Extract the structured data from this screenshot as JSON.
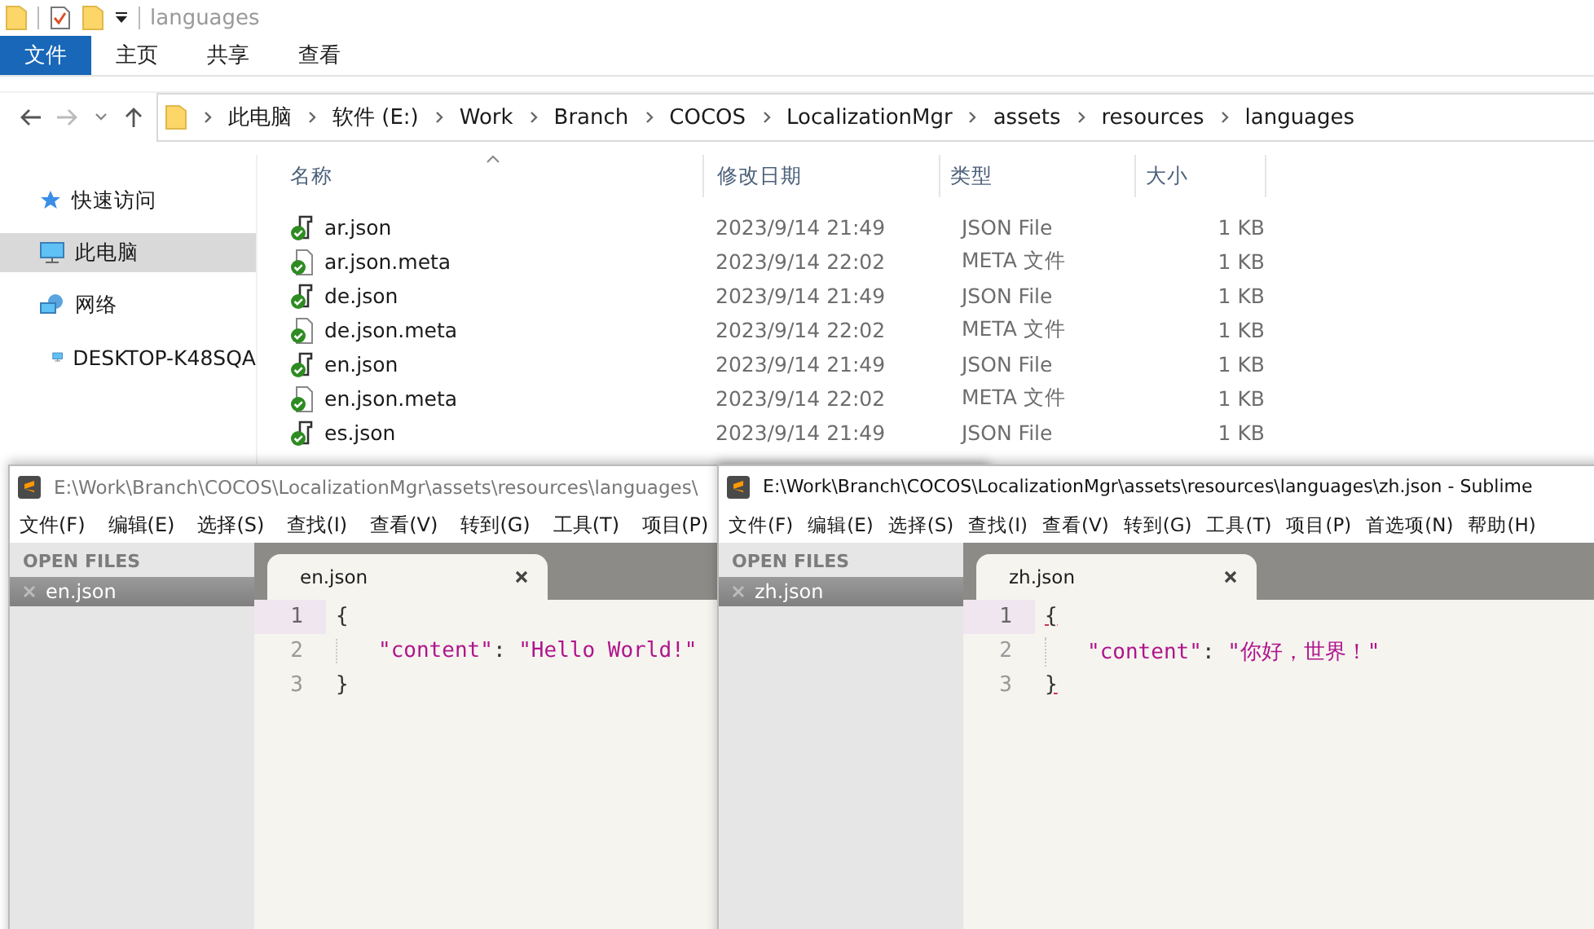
{
  "explorer": {
    "title": "languages",
    "ribbon_tabs": [
      {
        "label": "文件",
        "selected": true
      },
      {
        "label": "主页",
        "selected": false
      },
      {
        "label": "共享",
        "selected": false
      },
      {
        "label": "查看",
        "selected": false
      }
    ],
    "breadcrumb": [
      "此电脑",
      "软件 (E:)",
      "Work",
      "Branch",
      "COCOS",
      "LocalizationMgr",
      "assets",
      "resources",
      "languages"
    ],
    "nav_items": [
      {
        "label": "快速访问",
        "kind": "quick",
        "selected": false
      },
      {
        "label": "此电脑",
        "kind": "pc",
        "selected": true
      },
      {
        "label": "网络",
        "kind": "network",
        "selected": false,
        "children": [
          {
            "label": "DESKTOP-K48SQA",
            "kind": "pc",
            "selected": false
          }
        ]
      }
    ],
    "columns": [
      "名称",
      "修改日期",
      "类型",
      "大小"
    ],
    "files": [
      {
        "name": "ar.json",
        "modified": "2023/9/14 21:49",
        "type": "JSON File",
        "size": "1 KB",
        "kind": "json"
      },
      {
        "name": "ar.json.meta",
        "modified": "2023/9/14 22:02",
        "type": "META 文件",
        "size": "1 KB",
        "kind": "meta"
      },
      {
        "name": "de.json",
        "modified": "2023/9/14 21:49",
        "type": "JSON File",
        "size": "1 KB",
        "kind": "json"
      },
      {
        "name": "de.json.meta",
        "modified": "2023/9/14 22:02",
        "type": "META 文件",
        "size": "1 KB",
        "kind": "meta"
      },
      {
        "name": "en.json",
        "modified": "2023/9/14 21:49",
        "type": "JSON File",
        "size": "1 KB",
        "kind": "json"
      },
      {
        "name": "en.json.meta",
        "modified": "2023/9/14 22:02",
        "type": "META 文件",
        "size": "1 KB",
        "kind": "meta"
      },
      {
        "name": "es.json",
        "modified": "2023/9/14 21:49",
        "type": "JSON File",
        "size": "1 KB",
        "kind": "json"
      }
    ]
  },
  "editors": [
    {
      "title": "E:\\Work\\Branch\\COCOS\\LocalizationMgr\\assets\\resources\\languages\\",
      "menu": [
        "文件(F)",
        "编辑(E)",
        "选择(S)",
        "查找(I)",
        "查看(V)",
        "转到(G)",
        "工具(T)",
        "项目(P)"
      ],
      "sidebar_heading": "OPEN FILES",
      "open_files": [
        {
          "name": "en.json",
          "selected": true
        }
      ],
      "tab": "en.json",
      "lines": [
        {
          "number": "1",
          "current": true,
          "indented": false,
          "tokens": [
            {
              "kind": "punct",
              "text": "{"
            }
          ]
        },
        {
          "number": "2",
          "current": false,
          "indented": true,
          "tokens": [
            {
              "kind": "string",
              "text": "\"content\""
            },
            {
              "kind": "punct",
              "text": ": "
            },
            {
              "kind": "string",
              "text": "\"Hello World!\""
            }
          ]
        },
        {
          "number": "3",
          "current": false,
          "indented": false,
          "tokens": [
            {
              "kind": "punct",
              "text": "}"
            }
          ]
        }
      ]
    },
    {
      "title": "E:\\Work\\Branch\\COCOS\\LocalizationMgr\\assets\\resources\\languages\\zh.json - Sublime",
      "menu": [
        "文件(F)",
        "编辑(E)",
        "选择(S)",
        "查找(I)",
        "查看(V)",
        "转到(G)",
        "工具(T)",
        "项目(P)",
        "首选项(N)",
        "帮助(H)"
      ],
      "sidebar_heading": "OPEN FILES",
      "open_files": [
        {
          "name": "zh.json",
          "selected": true
        }
      ],
      "tab": "zh.json",
      "lines": [
        {
          "number": "1",
          "current": true,
          "indented": false,
          "tokens": [
            {
              "kind": "brace_match",
              "text": "{"
            }
          ]
        },
        {
          "number": "2",
          "current": false,
          "indented": true,
          "tokens": [
            {
              "kind": "string",
              "text": "\"content\""
            },
            {
              "kind": "punct",
              "text": ": "
            },
            {
              "kind": "string",
              "text": "\"你好，世界！\""
            }
          ]
        },
        {
          "number": "3",
          "current": false,
          "indented": false,
          "tokens": [
            {
              "kind": "brace_match",
              "text": "}"
            }
          ]
        }
      ]
    }
  ]
}
